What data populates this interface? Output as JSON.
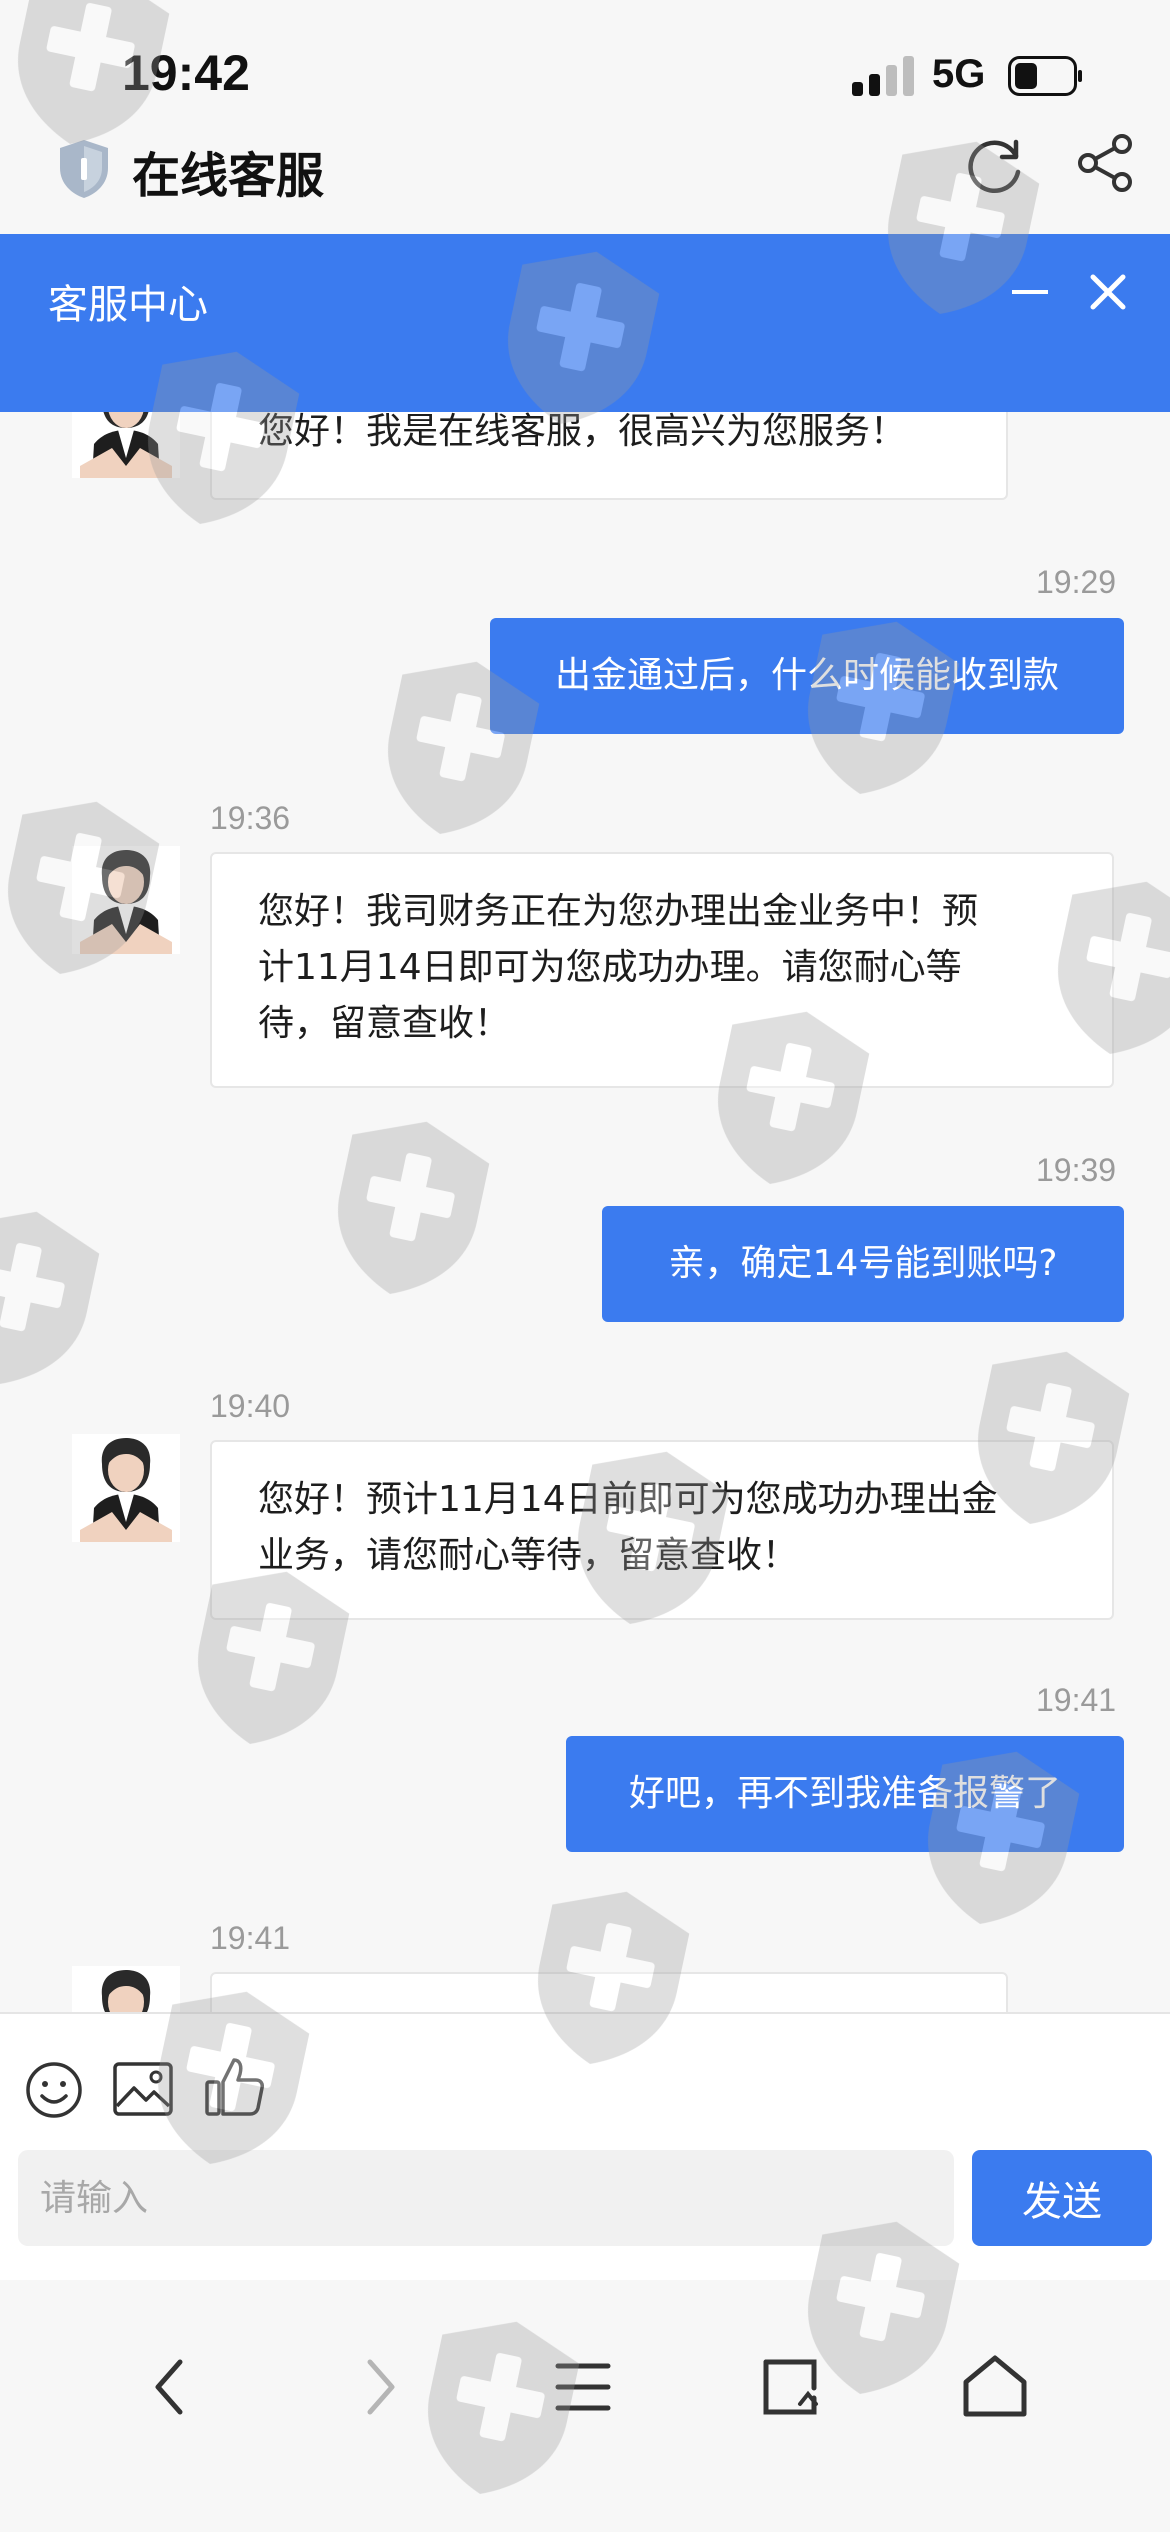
{
  "status_bar": {
    "time": "19:42",
    "network": "5G"
  },
  "browser": {
    "title": "在线客服"
  },
  "header": {
    "title": "客服中心"
  },
  "messages": [
    {
      "side": "in",
      "text": "您好！我是在线客服，很高兴为您服务！"
    },
    {
      "side": "out",
      "time": "19:29",
      "text": "出金通过后，什么时候能收到款"
    },
    {
      "side": "in",
      "time": "19:36",
      "lines": [
        "您好！我司财务正在为您办理出金业务中！预",
        "计11月14日即可为您成功办理。请您耐心等",
        "待，留意查收！"
      ]
    },
    {
      "side": "out",
      "time": "19:39",
      "text": "亲，确定14号能到账吗?"
    },
    {
      "side": "in",
      "time": "19:40",
      "lines": [
        "您好！预计11月14日前即可为您成功办理出金",
        "业务，请您耐心等待，留意查收！"
      ]
    },
    {
      "side": "out",
      "time": "19:41",
      "text": "好吧，再不到我准备报警了"
    },
    {
      "side": "in",
      "time": "19:41",
      "text": ""
    }
  ],
  "input": {
    "placeholder": "请输入",
    "value": "",
    "send_label": "发送"
  },
  "colors": {
    "accent": "#3b7bef",
    "background": "#f7f7f7"
  },
  "icons": {
    "toolbar": [
      "emoji-icon",
      "image-icon",
      "thumbs-up-icon"
    ],
    "nav": [
      "back-icon",
      "forward-icon",
      "menu-icon",
      "tabs-icon",
      "home-icon"
    ]
  }
}
